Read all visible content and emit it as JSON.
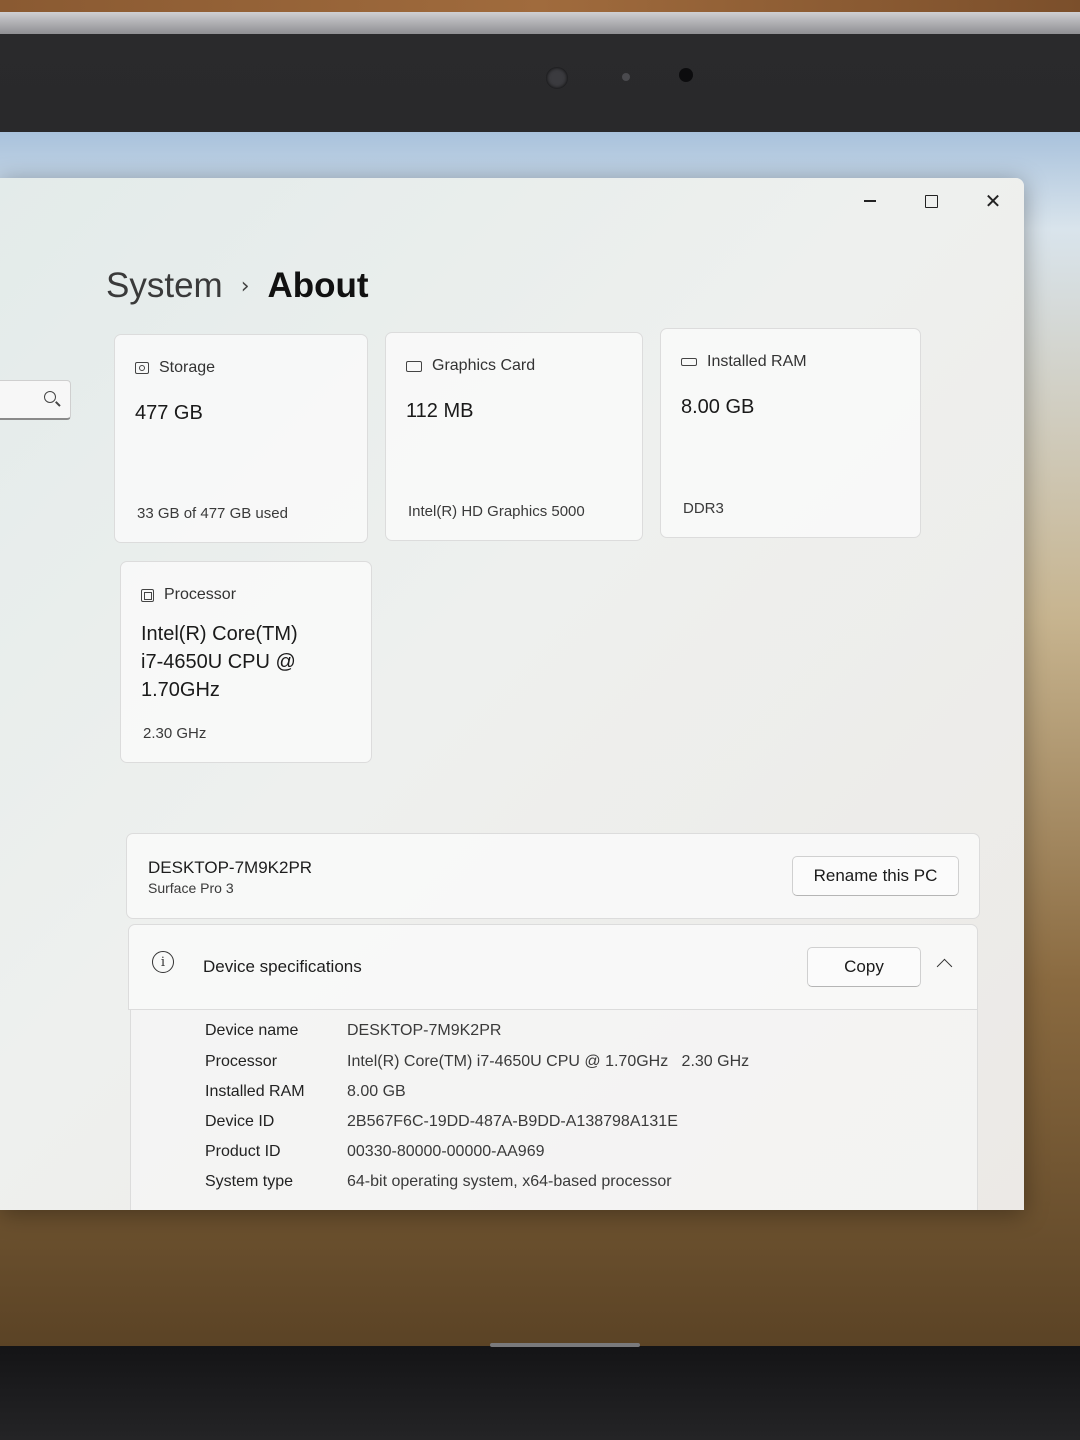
{
  "window": {
    "controls": {
      "minimize": "",
      "maximize": "",
      "close": "✕"
    }
  },
  "breadcrumb": {
    "parent": "System",
    "separator": "›",
    "current": "About"
  },
  "search": {
    "placeholder": ""
  },
  "cards": {
    "storage": {
      "label": "Storage",
      "value": "477 GB",
      "sub": "33 GB of 477 GB used"
    },
    "graphics": {
      "label": "Graphics Card",
      "value": "112 MB",
      "sub": "Intel(R) HD Graphics 5000"
    },
    "ram": {
      "label": "Installed RAM",
      "value": "8.00 GB",
      "sub": "DDR3"
    },
    "processor": {
      "label": "Processor",
      "value_lines": [
        "Intel(R) Core(TM)",
        "i7-4650U CPU @",
        "1.70GHz"
      ],
      "sub": "2.30 GHz"
    }
  },
  "device": {
    "name": "DESKTOP-7M9K2PR",
    "model": "Surface Pro 3",
    "rename_label": "Rename this PC"
  },
  "specs": {
    "title": "Device specifications",
    "copy_label": "Copy",
    "rows": [
      {
        "label": "Device name",
        "value": "DESKTOP-7M9K2PR"
      },
      {
        "label": "Processor",
        "value": "Intel(R) Core(TM) i7-4650U CPU @ 1.70GHz   2.30 GHz"
      },
      {
        "label": "Installed RAM",
        "value": "8.00 GB"
      },
      {
        "label": "Device ID",
        "value": "2B567F6C-19DD-487A-B9DD-A138798A131E"
      },
      {
        "label": "Product ID",
        "value": "00330-80000-00000-AA969"
      },
      {
        "label": "System type",
        "value": "64-bit operating system, x64-based processor"
      }
    ]
  }
}
